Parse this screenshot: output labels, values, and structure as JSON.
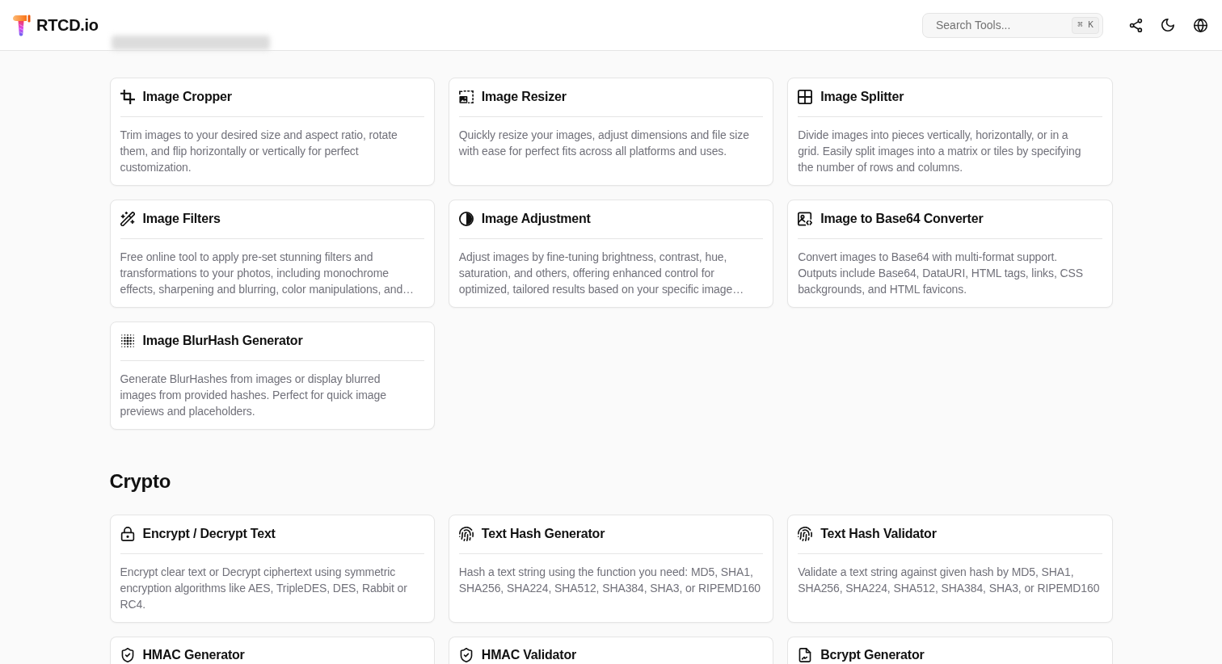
{
  "header": {
    "logo_text": "RTCD.io",
    "search": {
      "placeholder": "Search Tools...",
      "shortcut": "⌘ K"
    }
  },
  "sections": [
    {
      "tools": [
        {
          "kind": "crop",
          "name": "Image Cropper",
          "description": [
            "Trim images to your desired size and aspect ratio, rotate",
            "them, and flip horizontally or vertically for perfect",
            "customization."
          ]
        },
        {
          "kind": "resize",
          "name": "Image Resizer",
          "description": [
            "Quickly resize your images, adjust dimensions and file size",
            "with ease for perfect fits across all platforms and uses."
          ]
        },
        {
          "kind": "grid",
          "name": "Image Splitter",
          "description": [
            "Divide images into pieces vertically, horizontally, or in a",
            "grid. Easily split images into a matrix or tiles by specifying",
            "the number of rows and columns."
          ]
        },
        {
          "kind": "wand",
          "name": "Image Filters",
          "description": [
            "Free online tool to apply pre-set stunning filters and",
            "transformations to your photos, including monochrome",
            "effects, sharpening and blurring, color manipulations, and…"
          ]
        },
        {
          "kind": "contrast",
          "name": "Image Adjustment",
          "description": [
            "Adjust images by fine-tuning brightness, contrast, hue,",
            "saturation, and others, offering enhanced control for",
            "optimized, tailored results based on your specific image…"
          ]
        },
        {
          "kind": "imagecode",
          "name": "Image to Base64 Converter",
          "description": [
            "Convert images to Base64 with multi-format support.",
            "Outputs include Base64, DataURI, HTML tags, links, CSS",
            "backgrounds, and HTML favicons."
          ]
        },
        {
          "kind": "dots",
          "name": "Image BlurHash Generator",
          "description": [
            "Generate BlurHashes from images or display blurred",
            "images from provided hashes. Perfect for quick image",
            "previews and placeholders."
          ]
        }
      ]
    },
    {
      "title": "Crypto",
      "tools": [
        {
          "kind": "lock",
          "name": "Encrypt / Decrypt Text",
          "description": [
            "Encrypt clear text or Decrypt ciphertext using symmetric",
            "encryption algorithms like AES, TripleDES, DES, Rabbit or",
            "RC4."
          ]
        },
        {
          "kind": "fingerprint",
          "name": "Text Hash Generator",
          "description": [
            "Hash a text string using the function you need: MD5, SHA1,",
            "SHA256, SHA224, SHA512, SHA384, SHA3, or RIPEMD160"
          ]
        },
        {
          "kind": "fingerprint",
          "name": "Text Hash Validator",
          "description": [
            "Validate a text string against given hash by MD5, SHA1,",
            "SHA256, SHA224, SHA512, SHA384, SHA3, or RIPEMD160"
          ]
        },
        {
          "kind": "shield",
          "name": "HMAC Generator"
        },
        {
          "kind": "shield",
          "name": "HMAC Validator"
        },
        {
          "kind": "file",
          "name": "Bcrypt Generator"
        }
      ]
    }
  ]
}
